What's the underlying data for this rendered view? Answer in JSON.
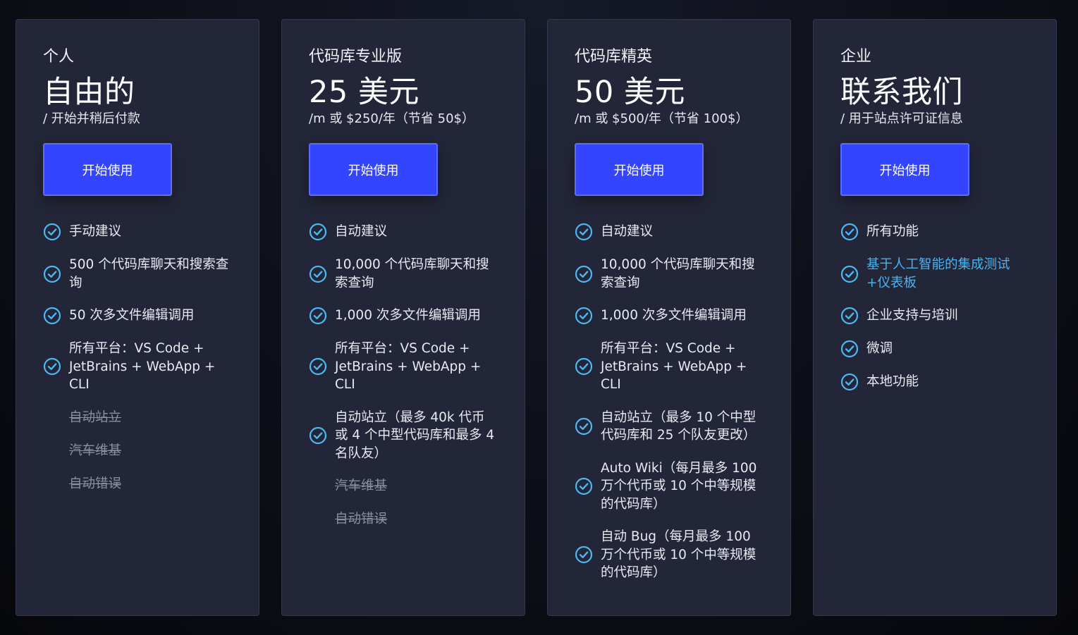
{
  "colors": {
    "background": "#0d0f18",
    "card": "#232638",
    "accent": "#3345ff",
    "check": "#4cb8f0",
    "link": "#47b4f2",
    "disabled": "#8b8f9e"
  },
  "plans": [
    {
      "name": "个人",
      "price": "自由的",
      "note": "/ 开始并稍后付款",
      "cta": "开始使用",
      "features": [
        {
          "text": "手动建议",
          "state": "included",
          "icon": "check-circle-icon"
        },
        {
          "text": "500 个代码库聊天和搜索查询",
          "state": "included",
          "icon": "check-circle-icon"
        },
        {
          "text": "50 次多文件编辑调用",
          "state": "included",
          "icon": "check-circle-icon"
        },
        {
          "text": "所有平台：VS Code + JetBrains + WebApp + CLI",
          "state": "included",
          "icon": "check-circle-icon"
        },
        {
          "text": "自动站立",
          "state": "excluded"
        },
        {
          "text": "汽车维基",
          "state": "excluded"
        },
        {
          "text": "自动错误",
          "state": "excluded"
        }
      ]
    },
    {
      "name": "代码库专业版",
      "price": "25 美元",
      "note": "/m 或 $250/年（节省 50$）",
      "cta": "开始使用",
      "features": [
        {
          "text": "自动建议",
          "state": "included",
          "icon": "check-circle-icon"
        },
        {
          "text": "10,000 个代码库聊天和搜索查询",
          "state": "included",
          "icon": "check-circle-icon"
        },
        {
          "text": "1,000 次多文件编辑调用",
          "state": "included",
          "icon": "check-circle-icon"
        },
        {
          "text": "所有平台：VS Code + JetBrains + WebApp + CLI",
          "state": "included",
          "icon": "check-circle-icon"
        },
        {
          "text": "自动站立（最多 40k 代币或 4 个中型代码库和最多 4 名队友）",
          "state": "included",
          "icon": "check-circle-icon"
        },
        {
          "text": "汽车维基",
          "state": "excluded"
        },
        {
          "text": "自动错误",
          "state": "excluded"
        }
      ]
    },
    {
      "name": "代码库精英",
      "price": "50 美元",
      "note": "/m 或 $500/年（节省 100$）",
      "cta": "开始使用",
      "features": [
        {
          "text": "自动建议",
          "state": "included",
          "icon": "check-circle-icon"
        },
        {
          "text": "10,000 个代码库聊天和搜索查询",
          "state": "included",
          "icon": "check-circle-icon"
        },
        {
          "text": "1,000 次多文件编辑调用",
          "state": "included",
          "icon": "check-circle-icon"
        },
        {
          "text": "所有平台：VS Code + JetBrains + WebApp + CLI",
          "state": "included",
          "icon": "check-circle-icon"
        },
        {
          "text": "自动站立（最多 10 个中型代码库和 25 个队友更改）",
          "state": "included",
          "icon": "check-circle-icon"
        },
        {
          "text": "Auto Wiki（每月最多 100 万个代币或 10 个中等规模的代码库）",
          "state": "included",
          "icon": "check-circle-icon"
        },
        {
          "text": "自动 Bug（每月最多 100 万个代币或 10 个中等规模的代码库）",
          "state": "included",
          "icon": "check-circle-icon"
        }
      ]
    },
    {
      "name": "企业",
      "price": "联系我们",
      "note": "/ 用于站点许可证信息",
      "cta": "开始使用",
      "features": [
        {
          "text": "所有功能",
          "state": "included",
          "icon": "check-circle-icon"
        },
        {
          "text": "基于人工智能的集成测试+仪表板",
          "state": "link",
          "icon": "check-circle-icon"
        },
        {
          "text": "企业支持与培训",
          "state": "included",
          "icon": "check-circle-icon"
        },
        {
          "text": "微调",
          "state": "included",
          "icon": "check-circle-icon"
        },
        {
          "text": "本地功能",
          "state": "included",
          "icon": "check-circle-icon"
        }
      ]
    }
  ]
}
